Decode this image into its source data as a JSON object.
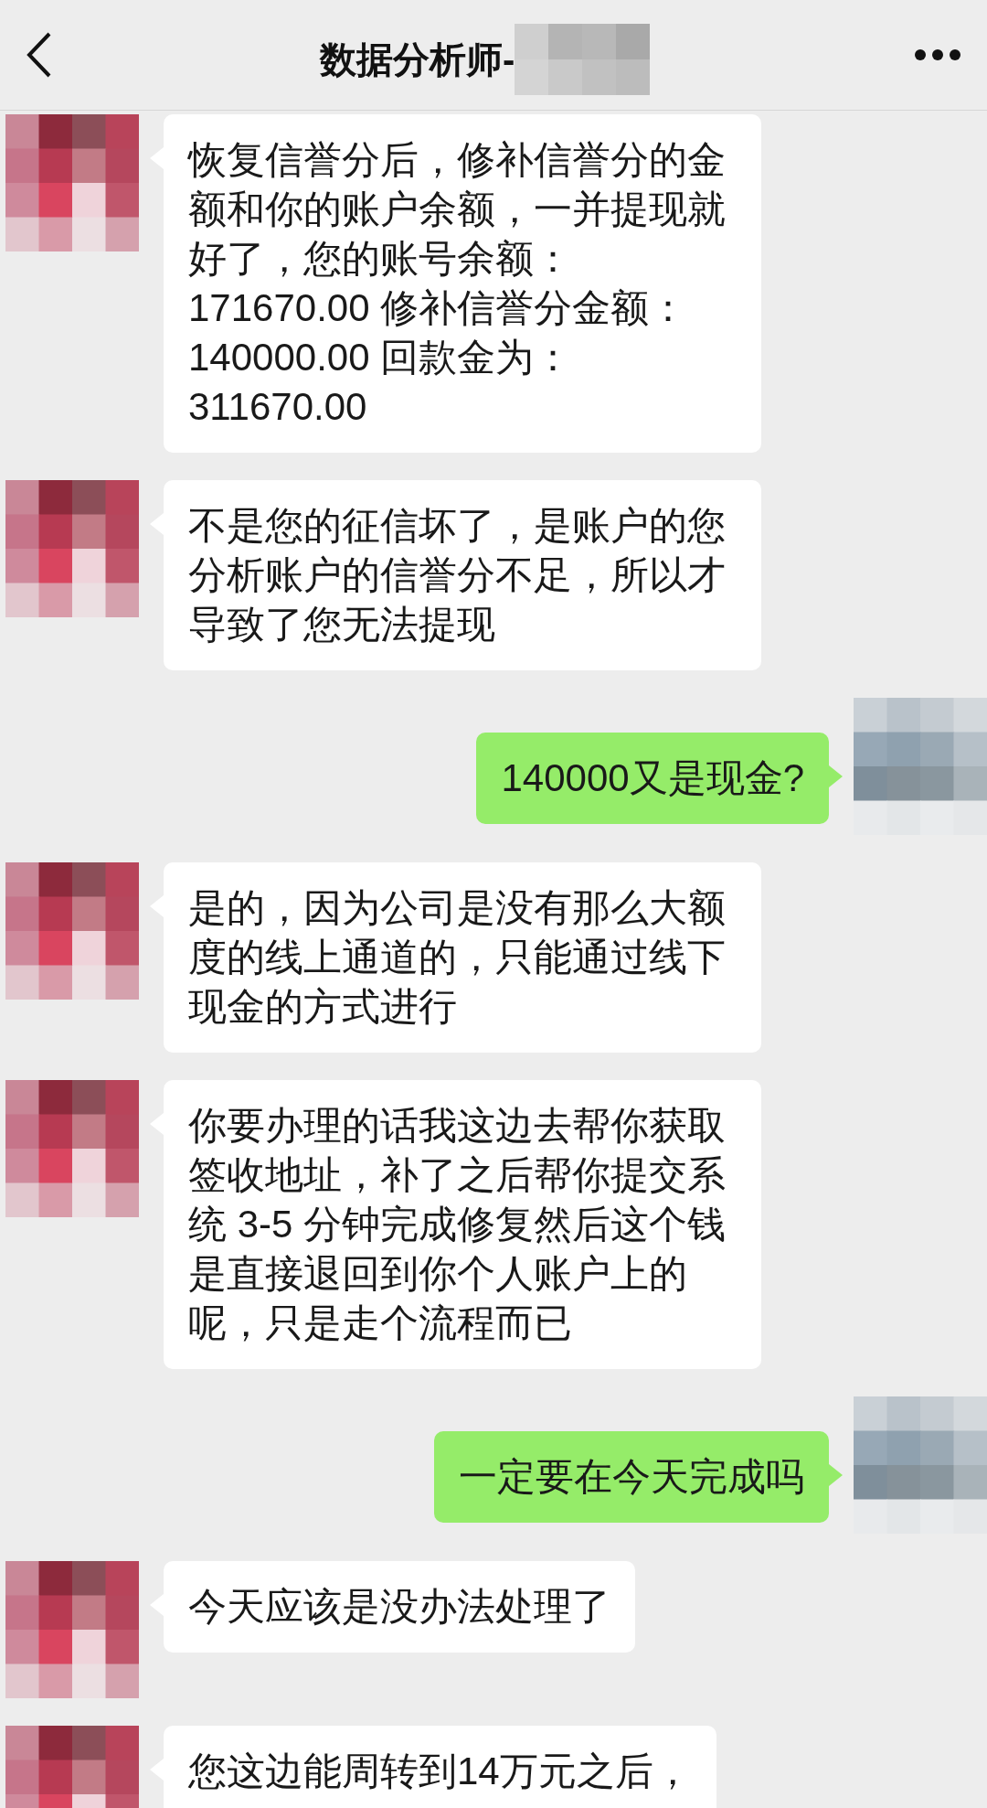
{
  "header": {
    "title": "数据分析师-"
  },
  "messages": [
    {
      "kind": "received",
      "text": "恢复信誉分后，修补信誉分的金额和你的账户余额，一并提现就好了，您的账号余额：171670.00 修补信誉分金额：140000.00 回款金为：311670.00"
    },
    {
      "kind": "received",
      "text": "不是您的征信坏了，是账户的您分析账户的信誉分不足，所以才导致了您无法提现"
    },
    {
      "kind": "sent",
      "text": "140000又是现金?"
    },
    {
      "kind": "received",
      "text": "是的，因为公司是没有那么大额度的线上通道的，只能通过线下现金的方式进行"
    },
    {
      "kind": "received",
      "text": "你要办理的话我这边去帮你获取签收地址，补了之后帮你提交系统 3-5 分钟完成修复然后这个钱是直接退回到你个人账户上的呢，只是走个流程而已"
    },
    {
      "kind": "sent",
      "text": "一定要在今天完成吗"
    },
    {
      "kind": "received",
      "text": "今天应该是没办法处理了"
    },
    {
      "kind": "received",
      "text": "您这边能周转到14万元之后，"
    }
  ]
}
